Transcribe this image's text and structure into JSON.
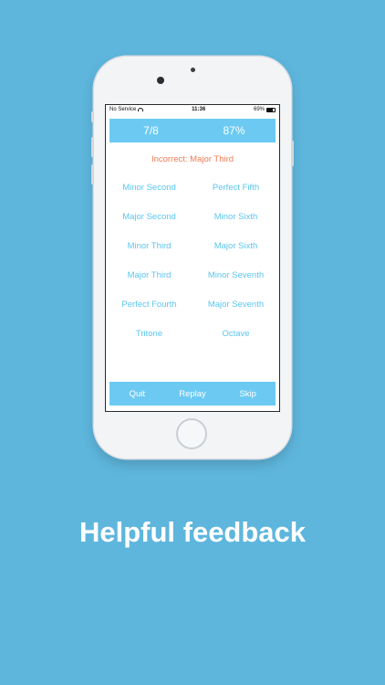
{
  "status_bar": {
    "carrier": "No Service",
    "time": "11:36",
    "battery": "69%",
    "battery_level": 0.69
  },
  "score": {
    "count": "7/8",
    "percent": "87%"
  },
  "feedback": "Incorrect: Major Third",
  "intervals": [
    "Minor Second",
    "Perfect Fifth",
    "Major Second",
    "Minor Sixth",
    "Minor Third",
    "Major Sixth",
    "Major Third",
    "Minor Seventh",
    "Perfect Fourth",
    "Major Seventh",
    "Tritone",
    "Octave"
  ],
  "controls": {
    "quit": "Quit",
    "replay": "Replay",
    "skip": "Skip"
  },
  "caption": "Helpful feedback",
  "colors": {
    "background": "#5eb6dd",
    "bar": "#6ccaf2",
    "interval": "#5ac6ef",
    "incorrect": "#f07b54"
  }
}
